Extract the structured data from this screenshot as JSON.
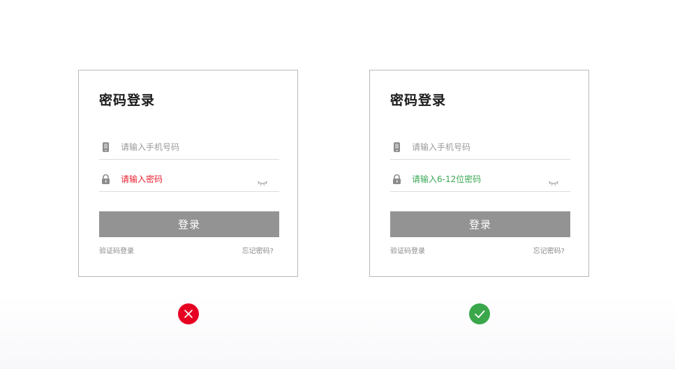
{
  "examples": [
    {
      "title": "密码登录",
      "phone_placeholder": "请输入手机号码",
      "password_message": "请输入密码",
      "password_state": "error",
      "button_label": "登录",
      "sms_login_link": "验证码登录",
      "forgot_link": "忘记密码?",
      "verdict": "incorrect"
    },
    {
      "title": "密码登录",
      "phone_placeholder": "请输入手机号码",
      "password_message": "请输入6-12位密码",
      "password_state": "success",
      "button_label": "登录",
      "sms_login_link": "验证码登录",
      "forgot_link": "忘记密码?",
      "verdict": "correct"
    }
  ],
  "colors": {
    "error": "#e8202f",
    "success": "#3aa854",
    "button": "#939393",
    "error_badge": "#e60021",
    "ok_badge": "#3aa74a"
  },
  "icons": {
    "phone": "phone-icon",
    "password": "lock-icon",
    "visibility": "eye-closed-icon",
    "bad": "cross-icon",
    "good": "check-icon"
  }
}
